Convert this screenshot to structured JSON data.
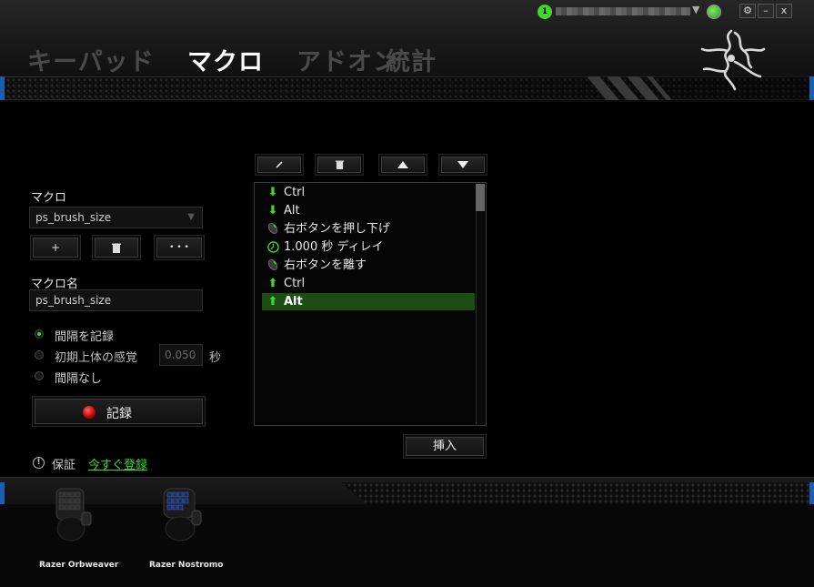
{
  "tabs": [
    {
      "label": "キーパッド",
      "active": false
    },
    {
      "label": "マクロ",
      "active": true
    },
    {
      "label": "アドオン",
      "active": false
    },
    {
      "label": "統計",
      "active": false
    }
  ],
  "user": {
    "notification_count": "1",
    "status_icon": "online-globe-icon"
  },
  "window_controls": {
    "settings": "⚙",
    "minimize": "–",
    "close": "x"
  },
  "macro": {
    "section_label": "マクロ",
    "selected": "ps_brush_size",
    "add_label": "+",
    "delete_icon": "trash-icon",
    "more_label": "• • •",
    "name_label": "マクロ名",
    "name_value": "ps_brush_size"
  },
  "recording": {
    "options": [
      {
        "label": "間隔を記録",
        "selected": true
      },
      {
        "label": "初期上体の感覚",
        "selected": false,
        "value": "0.050",
        "unit": "秒"
      },
      {
        "label": "間隔なし",
        "selected": false
      }
    ],
    "record_label": "記録"
  },
  "toolbar": {
    "edit_icon": "pencil-icon",
    "delete_icon": "trash-icon",
    "up_icon": "arrow-up-icon",
    "down_icon": "arrow-down-icon"
  },
  "events": [
    {
      "icon": "down-arrow",
      "label": "Ctrl"
    },
    {
      "icon": "down-arrow",
      "label": "Alt"
    },
    {
      "icon": "mouse",
      "label": "右ボタンを押し下げ"
    },
    {
      "icon": "clock",
      "label": "1.000 秒 ディレイ"
    },
    {
      "icon": "mouse",
      "label": "右ボタンを離す"
    },
    {
      "icon": "up-arrow",
      "label": "Ctrl"
    },
    {
      "icon": "up-arrow",
      "label": "Alt",
      "selected": true
    }
  ],
  "insert_label": "挿入",
  "warranty": {
    "label": "保証",
    "link": "今すぐ登録"
  },
  "devices": [
    {
      "name": "Razer Orbweaver"
    },
    {
      "name": "Razer Nostromo"
    }
  ],
  "colors": {
    "accent": "#44d62c",
    "selection": "#1c4d12",
    "record": "#d00000",
    "edge": "#1a5fb4"
  }
}
